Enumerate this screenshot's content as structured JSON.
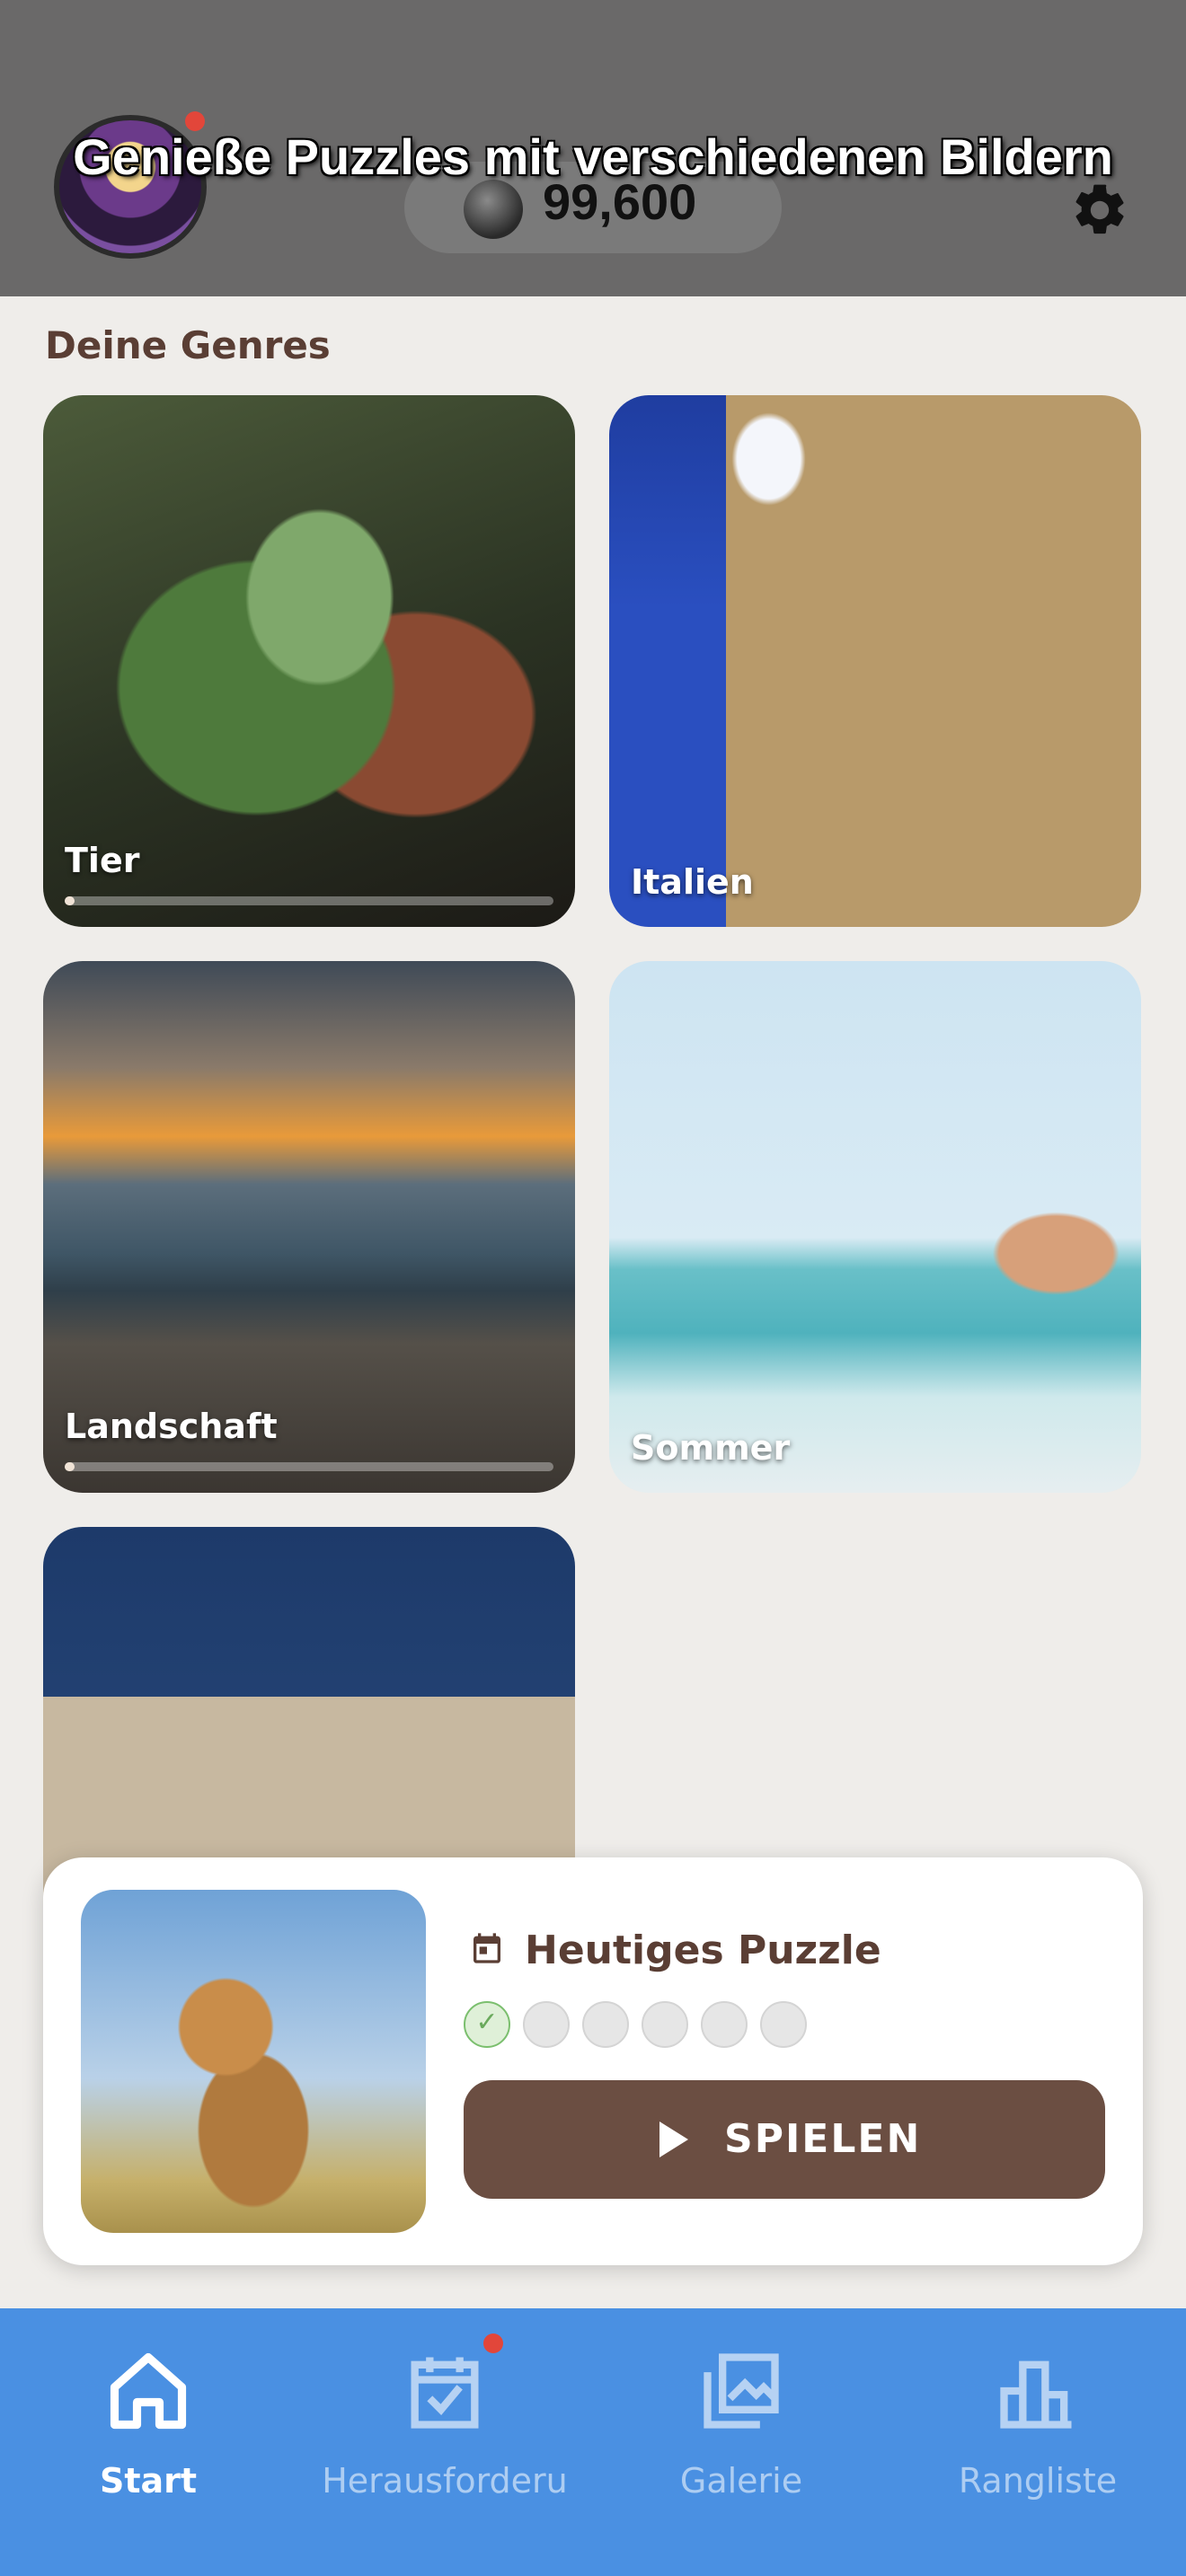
{
  "header": {
    "coins": "99,600",
    "banner": "Genieße Puzzles mit verschiedenen Bildern"
  },
  "genres": {
    "title": "Deine Genres",
    "items": [
      {
        "label": "Tier",
        "progress": 0.02
      },
      {
        "label": "Italien"
      },
      {
        "label": "Landschaft",
        "progress": 0.02
      },
      {
        "label": "Sommer"
      },
      {
        "label": ""
      }
    ]
  },
  "daily": {
    "title": "Heutiges Puzzle",
    "steps_done": 1,
    "steps_total": 6,
    "play_label": "SPIELEN"
  },
  "nav": {
    "items": [
      {
        "label": "Start",
        "icon": "home-icon",
        "active": true
      },
      {
        "label": "Herausforderu",
        "icon": "calendar-check-icon",
        "badge": true
      },
      {
        "label": "Galerie",
        "icon": "gallery-icon"
      },
      {
        "label": "Rangliste",
        "icon": "leaderboard-icon"
      }
    ]
  },
  "colors": {
    "header_bg": "#6a6969",
    "accent_brown": "#6b4e42",
    "nav_blue": "#4a90e2",
    "badge_red": "#e2463a"
  }
}
